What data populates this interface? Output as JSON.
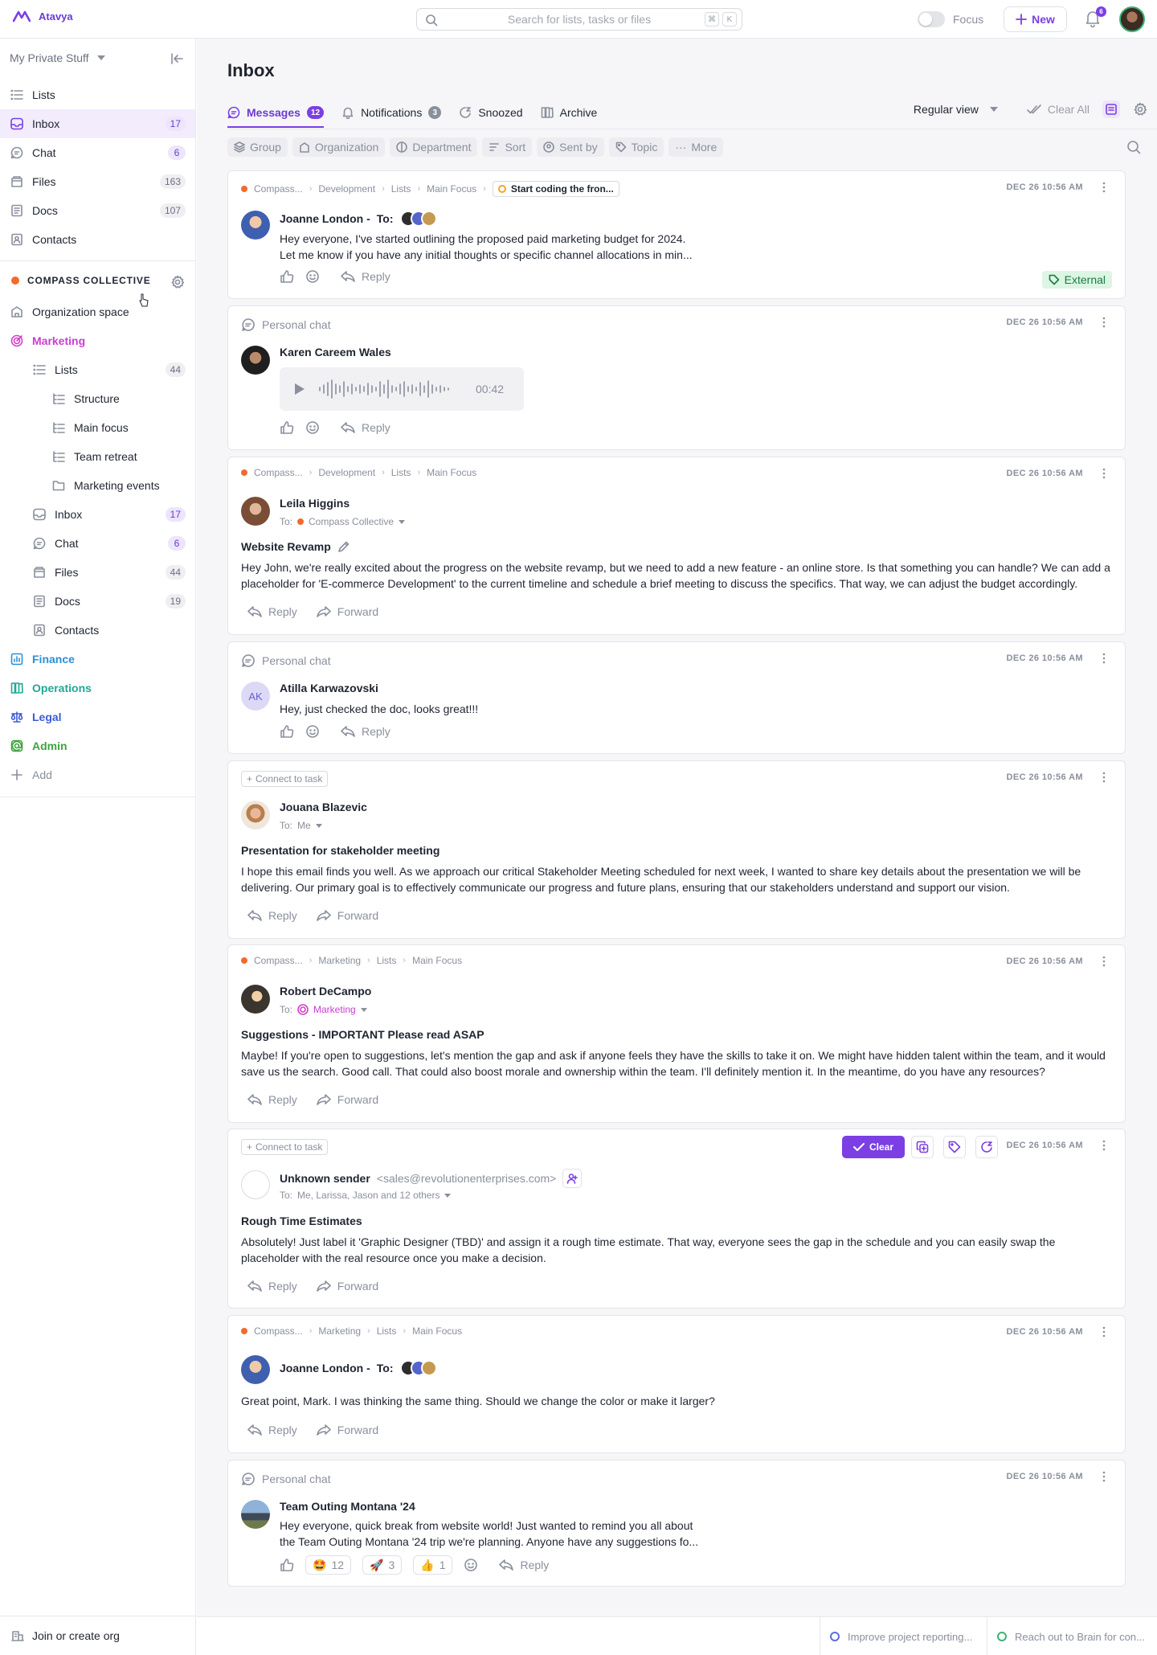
{
  "app": {
    "name": "Atavya"
  },
  "topbar": {
    "search_placeholder": "Search for lists, tasks or files",
    "shortcut_keys": [
      "⌘",
      "K"
    ],
    "focus_label": "Focus",
    "new_label": "New",
    "notification_count": "6"
  },
  "sidebar": {
    "workspace": "My Private Stuff",
    "items": [
      {
        "label": "Lists",
        "count": ""
      },
      {
        "label": "Inbox",
        "count": "17"
      },
      {
        "label": "Chat",
        "count": "6"
      },
      {
        "label": "Files",
        "count": "163"
      },
      {
        "label": "Docs",
        "count": "107"
      },
      {
        "label": "Contacts",
        "count": ""
      }
    ],
    "org_name": "COMPASS COLLECTIVE",
    "org_space": "Organization space",
    "marketing": {
      "label": "Marketing",
      "lists_label": "Lists",
      "lists_count": "44",
      "lists": [
        "Structure",
        "Main focus",
        "Team retreat",
        "Marketing events"
      ],
      "items": [
        {
          "label": "Inbox",
          "count": "17"
        },
        {
          "label": "Chat",
          "count": "6"
        },
        {
          "label": "Files",
          "count": "44"
        },
        {
          "label": "Docs",
          "count": "19"
        },
        {
          "label": "Contacts",
          "count": ""
        }
      ]
    },
    "spaces": [
      {
        "label": "Finance",
        "color": "#2b8fd6"
      },
      {
        "label": "Operations",
        "color": "#1fa896"
      },
      {
        "label": "Legal",
        "color": "#3a5bd9"
      },
      {
        "label": "Admin",
        "color": "#3ea33e"
      }
    ],
    "add_label": "Add",
    "join_label": "Join or create org"
  },
  "main": {
    "title": "Inbox",
    "tabs": [
      {
        "label": "Messages",
        "badge": "12"
      },
      {
        "label": "Notifications",
        "badge": "3"
      },
      {
        "label": "Snoozed",
        "badge": ""
      },
      {
        "label": "Archive",
        "badge": ""
      }
    ],
    "view_label": "Regular view",
    "clear_all_label": "Clear All",
    "filters": [
      "Group",
      "Organization",
      "Department",
      "Sort",
      "Sent by",
      "Topic",
      "More"
    ]
  },
  "messages": [
    {
      "crumbs": [
        "Compass...",
        "Development",
        "Lists",
        "Main Focus"
      ],
      "task": "Start coding the fron...",
      "date": "DEC 26 10:56 AM",
      "sender": "Joanne London -",
      "to_label": "To:",
      "body": "Hey everyone, I've started outlining the proposed paid marketing budget for 2024.\nLet me know if you have any initial thoughts or specific channel allocations in min...",
      "reply": "Reply",
      "tag": "External"
    },
    {
      "context": "Personal chat",
      "date": "DEC 26 10:56 AM",
      "sender": "Karen Careem Wales",
      "duration": "00:42",
      "reply": "Reply"
    },
    {
      "crumbs": [
        "Compass...",
        "Development",
        "Lists",
        "Main Focus"
      ],
      "date": "DEC 26 10:56 AM",
      "sender": "Leila Higgins",
      "to_label": "To:",
      "to": "Compass Collective",
      "subject": "Website Revamp",
      "body": "Hey John, we're really excited about the progress on the website revamp, but we need to add a new feature - an online store. Is that something you can handle? We can add a placeholder for 'E-commerce Development' to the current timeline and schedule a brief meeting to discuss the specifics. That way, we can adjust the budget accordingly.",
      "reply": "Reply",
      "forward": "Forward"
    },
    {
      "context": "Personal chat",
      "date": "DEC 26 10:56 AM",
      "initials": "AK",
      "sender": "Atilla Karwazovski",
      "body": "Hey, just checked the doc, looks great!!!",
      "reply": "Reply"
    },
    {
      "connect": "Connect to task",
      "date": "DEC 26 10:56 AM",
      "sender": "Jouana Blazevic",
      "to_label": "To:",
      "to": "Me",
      "subject": "Presentation for stakeholder meeting",
      "body": "I hope this email finds you well. As we approach our critical Stakeholder Meeting scheduled for next week, I wanted to share key details about the presentation we will be delivering. Our primary goal is to effectively communicate our progress and future plans, ensuring that our stakeholders understand and support our vision.",
      "reply": "Reply",
      "forward": "Forward"
    },
    {
      "crumbs": [
        "Compass...",
        "Marketing",
        "Lists",
        "Main Focus"
      ],
      "date": "DEC 26 10:56 AM",
      "sender": "Robert DeCampo",
      "to_label": "To:",
      "to": "Marketing",
      "subject": "Suggestions - IMPORTANT Please read ASAP",
      "body": "Maybe! If you're open to suggestions, let's mention the gap and ask if anyone feels they have the skills to take it on. We might have hidden talent within the team, and it would save us the search. Good call. That could also boost morale and ownership within the team. I'll definitely mention it. In the meantime, do you have any resources?",
      "reply": "Reply",
      "forward": "Forward"
    },
    {
      "connect": "Connect to task",
      "clear": "Clear",
      "date": "DEC 26 10:56 AM",
      "sender": "Unknown sender",
      "email": "<sales@revolutionenterprises.com>",
      "to_label": "To:",
      "to": "Me, Larissa, Jason and 12 others",
      "subject": "Rough Time Estimates",
      "body": "Absolutely! Just label it 'Graphic Designer (TBD)' and assign it a rough time estimate. That way, everyone sees the gap in the schedule and you can easily swap the placeholder with the real resource once you make a decision.",
      "reply": "Reply",
      "forward": "Forward"
    },
    {
      "crumbs": [
        "Compass...",
        "Marketing",
        "Lists",
        "Main Focus"
      ],
      "date": "DEC 26 10:56 AM",
      "sender": "Joanne London -",
      "to_label": "To:",
      "body": "Great point, Mark. I was thinking the same thing. Should we change the color or make it larger?",
      "reply": "Reply",
      "forward": "Forward"
    },
    {
      "context": "Personal chat",
      "date": "DEC 26 10:56 AM",
      "sender": "Team Outing Montana '24",
      "body": "Hey everyone, quick break from website world! Just wanted to remind you all about\nthe Team Outing Montana '24 trip we're planning. Anyone have any suggestions fo...",
      "reactions": [
        {
          "emoji": "🤩",
          "count": "12"
        },
        {
          "emoji": "🚀",
          "count": "3"
        },
        {
          "emoji": "👍",
          "count": "1"
        }
      ],
      "reply": "Reply"
    }
  ],
  "footer": [
    {
      "label": "Improve project reporting...",
      "color": "#5b6ee1"
    },
    {
      "label": "Reach out to Brain for con...",
      "color": "#3bb273"
    }
  ],
  "colors": {
    "accent": "#7b3fe4",
    "accent_light": "#f2ecfd",
    "external_bg": "#dcf5e4"
  }
}
